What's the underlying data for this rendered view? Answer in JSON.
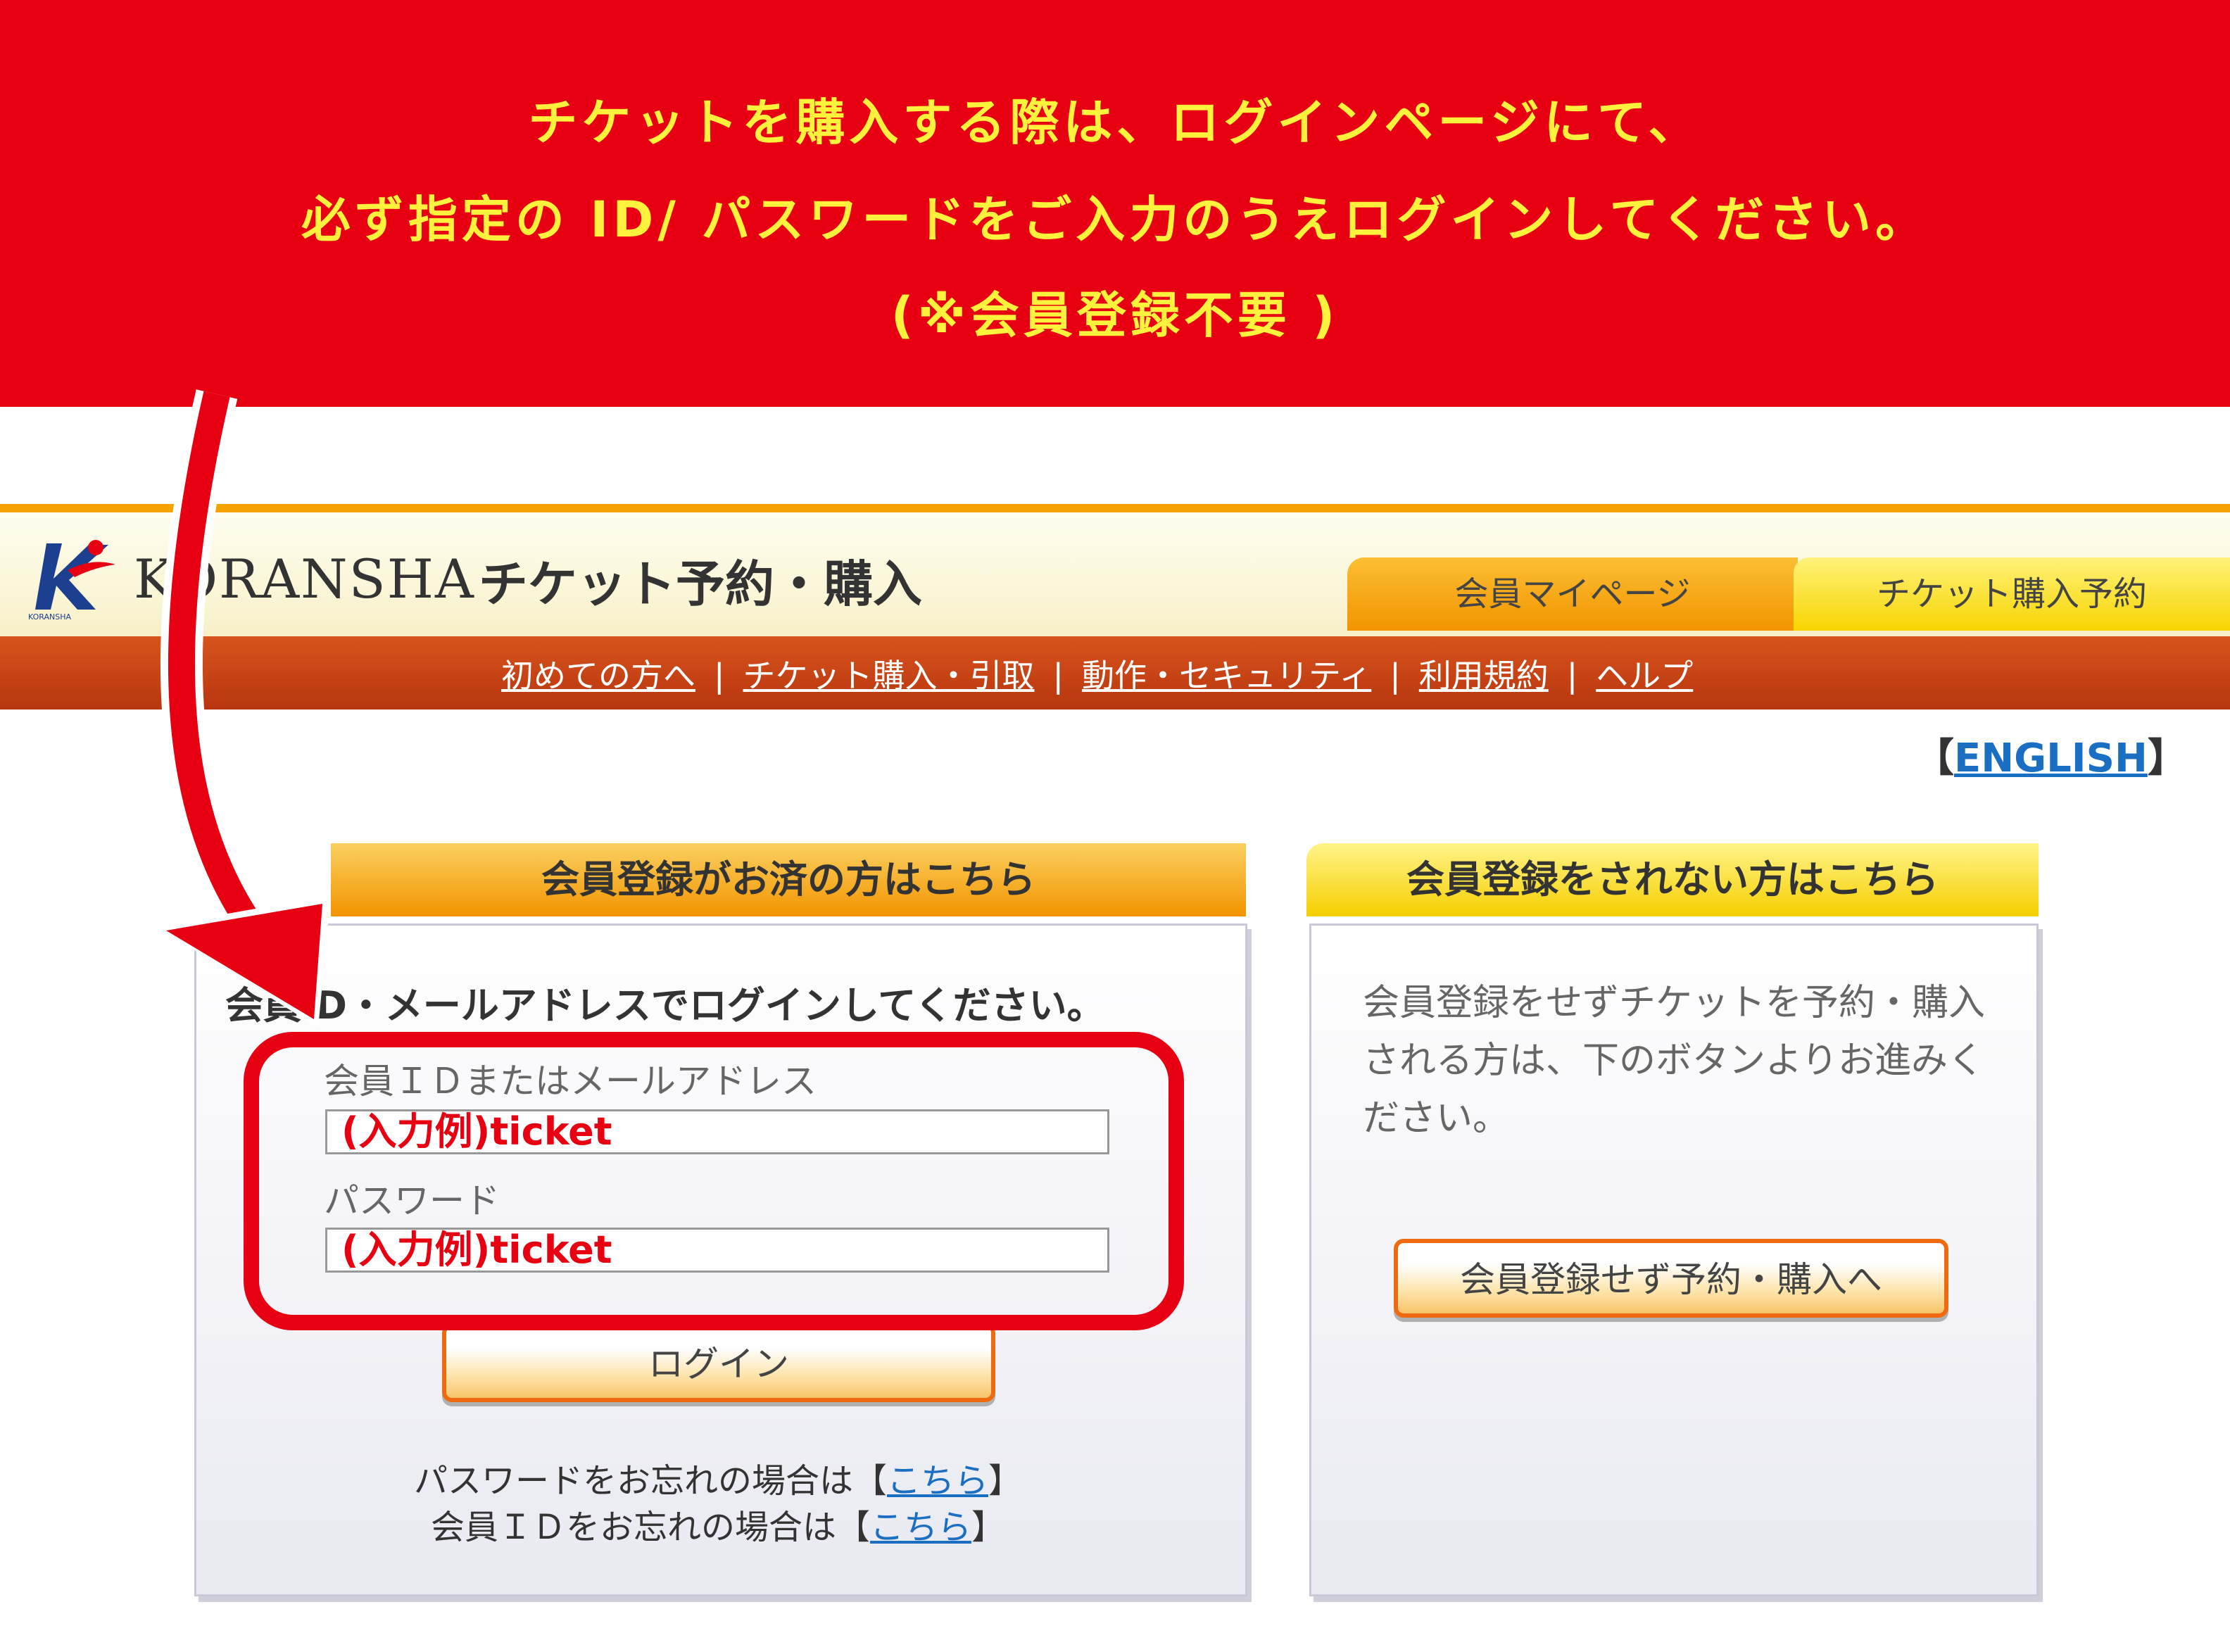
{
  "banner": {
    "line1": "チケットを購入する際は、ログインページにて、",
    "line2": "必ず指定の ID/ パスワードをご入力のうえログインしてください。",
    "line3": "(※会員登録不要 )"
  },
  "header": {
    "logo_text": "KORANSHA",
    "logo_sub": "KORANSHA",
    "site_title": "チケット予約・購入",
    "tabs": [
      "会員マイページ",
      "チケット購入予約"
    ]
  },
  "nav": {
    "items": [
      "初めての方へ",
      "チケット購入・引取",
      "動作・セキュリティ",
      "利用規約",
      "ヘルプ"
    ],
    "separator": "|"
  },
  "lang": {
    "open": "【",
    "label": "ENGLISH",
    "close": "】"
  },
  "member_panel": {
    "heading": "会員登録がお済の方はこちら",
    "prompt": "会員ID・メールアドレスでログインしてください。",
    "id_label": "会員ＩＤまたはメールアドレス",
    "id_value": "(入力例)ticket",
    "password_label": "パスワード",
    "password_value": "(入力例)ticket",
    "login_button": "ログイン",
    "forgot_password_text": "パスワードをお忘れの場合は",
    "forgot_id_text": "会員ＩＤをお忘れの場合は",
    "link_open": "【",
    "link_label": "こちら",
    "link_close": "】"
  },
  "guest_panel": {
    "heading": "会員登録をされない方はこちら",
    "description": "会員登録をせずチケットを予約・購入される方は、下のボタンよりお進みください。",
    "button": "会員登録せず予約・購入へ"
  },
  "colors": {
    "banner_red": "#e60012",
    "banner_text": "#fff23d",
    "header_orange": "#f29400",
    "nav_brown": "#c4410f",
    "link_blue": "#1a6fc2"
  }
}
